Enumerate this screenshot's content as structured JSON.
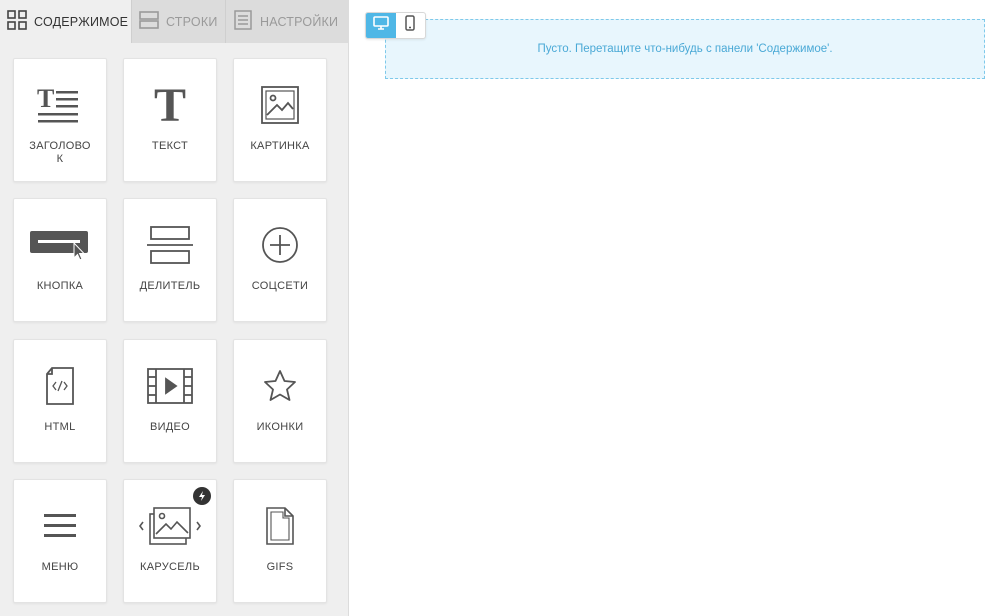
{
  "tabs": [
    {
      "label": "СОДЕРЖИМОЕ",
      "icon": "grid-icon",
      "active": true
    },
    {
      "label": "СТРОКИ",
      "icon": "rows-icon",
      "active": false
    },
    {
      "label": "НАСТРОЙКИ",
      "icon": "settings-icon",
      "active": false
    }
  ],
  "blocks": [
    {
      "label": "ЗАГОЛОВОК",
      "icon": "heading-icon"
    },
    {
      "label": "ТЕКСТ",
      "icon": "text-icon"
    },
    {
      "label": "КАРТИНКА",
      "icon": "image-icon"
    },
    {
      "label": "КНОПКА",
      "icon": "button-icon"
    },
    {
      "label": "ДЕЛИТЕЛЬ",
      "icon": "divider-icon"
    },
    {
      "label": "СОЦСЕТИ",
      "icon": "social-icon"
    },
    {
      "label": "HTML",
      "icon": "html-file-icon"
    },
    {
      "label": "ВИДЕО",
      "icon": "video-icon"
    },
    {
      "label": "ИКОНКИ",
      "icon": "star-icon"
    },
    {
      "label": "МЕНЮ",
      "icon": "menu-icon"
    },
    {
      "label": "КАРУСЕЛЬ",
      "icon": "carousel-icon",
      "badge": "lightning-icon"
    },
    {
      "label": "GIFS",
      "icon": "gif-file-icon"
    }
  ],
  "canvas": {
    "device_modes": [
      {
        "icon": "desktop-icon",
        "active": true
      },
      {
        "icon": "mobile-icon",
        "active": false
      }
    ],
    "empty_message": "Пусто. Перетащите что-нибудь с панели 'Содержимое'."
  },
  "colors": {
    "accent": "#4fb7e6",
    "drop_zone_bg": "#e8f6fd",
    "drop_zone_text": "#4aa9d6"
  }
}
